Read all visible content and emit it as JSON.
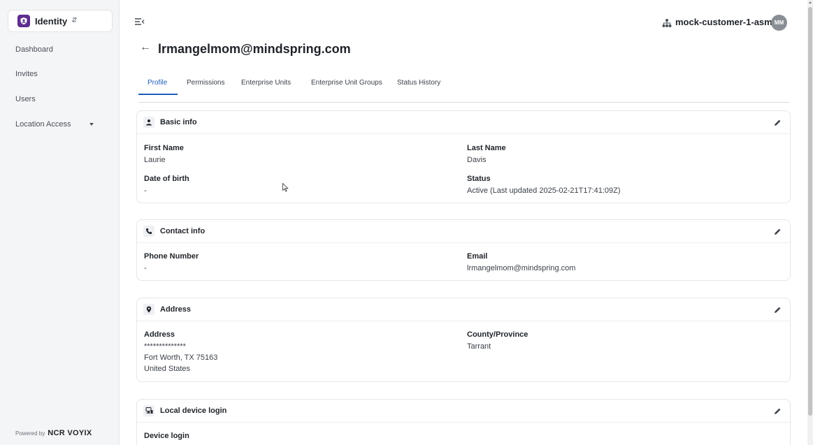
{
  "app": {
    "name": "Identity",
    "logo_icon": "shield-user-icon",
    "switch_icon": "updown-chevron-icon",
    "accent": "#5d2e8f"
  },
  "sidebar": {
    "items": [
      {
        "label": "Dashboard"
      },
      {
        "label": "Invites"
      },
      {
        "label": "Users"
      },
      {
        "label": "Location Access",
        "icon": "caret-down-icon"
      }
    ],
    "powered_by_prefix": "Powered by",
    "powered_by_brand": "NCR VOYIX"
  },
  "topbar": {
    "menu_icon": "menu-collapse-icon",
    "org_icon": "org-hierarchy-icon",
    "org_name": "mock-customer-1-asm",
    "avatar_initials": "MM"
  },
  "page": {
    "back_icon": "arrow-left-icon",
    "title": "lrmangelmom@mindspring.com"
  },
  "tabs": [
    {
      "label": "Profile",
      "active": true
    },
    {
      "label": "Permissions"
    },
    {
      "label": "Enterprise Units"
    },
    {
      "label": "Enterprise Unit Groups"
    },
    {
      "label": "Status History"
    }
  ],
  "cards": {
    "basic": {
      "title": "Basic info",
      "icon": "person-icon",
      "first_name_label": "First Name",
      "first_name": "Laurie",
      "last_name_label": "Last Name",
      "last_name": "Davis",
      "dob_label": "Date of birth",
      "dob": "-",
      "status_label": "Status",
      "status": "Active (Last updated 2025-02-21T17:41:09Z)"
    },
    "contact": {
      "title": "Contact info",
      "icon": "phone-icon",
      "phone_label": "Phone Number",
      "phone": "-",
      "email_label": "Email",
      "email": "lrmangelmom@mindspring.com"
    },
    "address": {
      "title": "Address",
      "icon": "location-pin-icon",
      "address_label": "Address",
      "address_line1": "**************",
      "address_line2": "Fort Worth, TX 75163",
      "address_line3": "United States",
      "county_label": "County/Province",
      "county": "Tarrant"
    },
    "device": {
      "title": "Local device login",
      "icon": "device-login-icon",
      "device_login_label": "Device login"
    }
  },
  "colors": {
    "tab_active": "#1e5fb8",
    "sidebar_bg": "#f4f5f6"
  }
}
